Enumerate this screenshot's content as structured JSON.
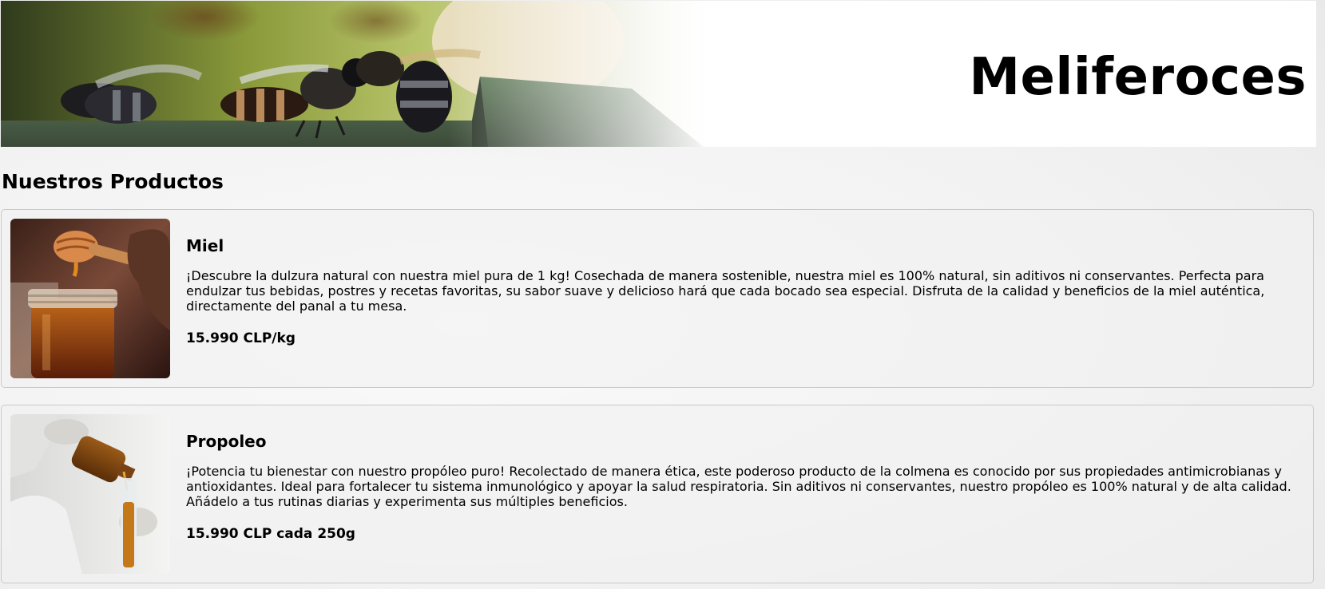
{
  "header": {
    "site_title": "Meliferoces",
    "banner_image": "bees-on-hive-photo"
  },
  "section": {
    "title": "Nuestros Productos"
  },
  "products": [
    {
      "name": "Miel",
      "description": "¡Descubre la dulzura natural con nuestra miel pura de 1 kg! Cosechada de manera sostenible, nuestra miel es 100% natural, sin aditivos ni conservantes. Perfecta para endulzar tus bebidas, postres y recetas favoritas, su sabor suave y delicioso hará que cada bocado sea especial. Disfruta de la calidad y beneficios de la miel auténtica, directamente del panal a tu mesa.",
      "price": "15.990 CLP/kg",
      "image": "honey-jar-with-dipper-photo"
    },
    {
      "name": "Propoleo",
      "description": "¡Potencia tu bienestar con nuestro propóleo puro! Recolectado de manera ética, este poderoso producto de la colmena es conocido por sus propiedades antimicrobianas y antioxidantes. Ideal para fortalecer tu sistema inmunológico y apoyar la salud respiratoria. Sin aditivos ni conservantes, nuestro propóleo es 100% natural y de alta calidad. Añádelo a tus rutinas diarias y experimenta sus múltiples beneficios.",
      "price": "15.990 CLP cada 250g",
      "image": "propolis-bottle-pouring-photo"
    }
  ]
}
